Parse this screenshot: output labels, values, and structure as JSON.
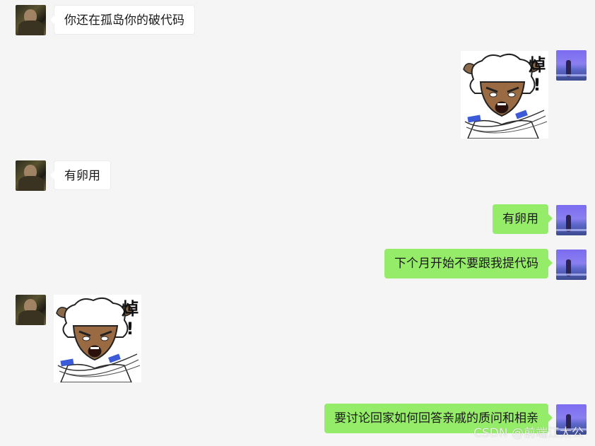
{
  "messages": [
    {
      "side": "left",
      "type": "text",
      "text": "你还在孤岛你的破代码",
      "avatar": "dark-portrait-avatar"
    },
    {
      "side": "right",
      "type": "sticker",
      "sticker": {
        "caption": "焯",
        "exclaim": "!"
      },
      "avatar": "purple-portrait-avatar"
    },
    {
      "side": "left",
      "type": "text",
      "text": "有卵用",
      "avatar": "dark-portrait-avatar"
    },
    {
      "side": "right",
      "type": "text",
      "text": "有卵用",
      "avatar": "purple-portrait-avatar"
    },
    {
      "side": "right",
      "type": "text",
      "text": "下个月开始不要跟我提代码",
      "avatar": "purple-portrait-avatar"
    },
    {
      "side": "left",
      "type": "sticker",
      "sticker": {
        "caption": "焯",
        "exclaim": "!"
      },
      "avatar": "dark-portrait-avatar"
    },
    {
      "side": "right",
      "type": "text",
      "text": "要讨论回家如何回答亲戚的质问和相亲",
      "avatar": "purple-portrait-avatar"
    }
  ],
  "watermark": "CSDN @前端江太公",
  "colors": {
    "background": "#f5f5f5",
    "bubble_sent": "#95ec69",
    "bubble_received": "#ffffff"
  }
}
